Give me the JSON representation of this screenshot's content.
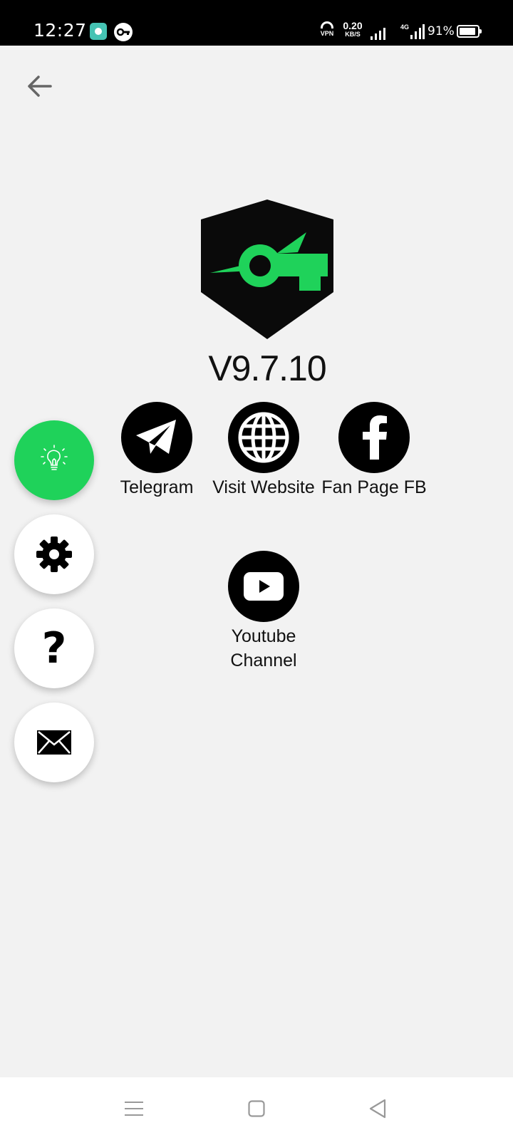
{
  "status_bar": {
    "time": "12:27",
    "vpn_label": "VPN",
    "speed_value": "0.20",
    "speed_unit": "KB/S",
    "network_label": "4G",
    "battery_percent_text": "91%",
    "battery_level": 0.91
  },
  "about": {
    "version": "V9.7.10",
    "brand_color": "#1fd25a"
  },
  "links": [
    {
      "label": "Telegram",
      "icon": "telegram-icon"
    },
    {
      "label": "Visit Website",
      "icon": "globe-icon"
    },
    {
      "label": "Fan Page FB",
      "icon": "facebook-icon"
    },
    {
      "label": "Youtube Channel",
      "icon": "youtube-icon"
    }
  ],
  "side_actions": [
    {
      "icon": "lightbulb-icon",
      "color": "#1fd25a"
    },
    {
      "icon": "gear-icon"
    },
    {
      "icon": "question-mark-icon",
      "glyph": "?"
    },
    {
      "icon": "envelope-icon"
    }
  ]
}
